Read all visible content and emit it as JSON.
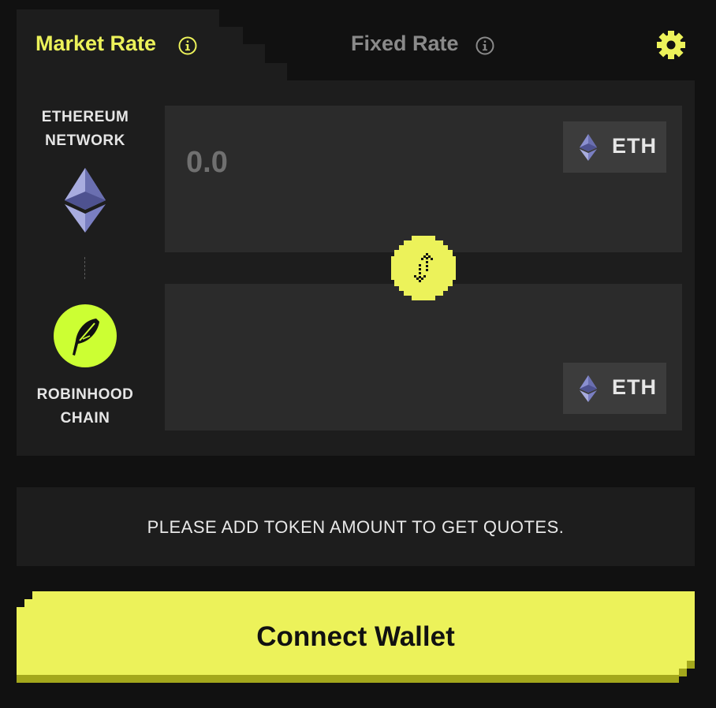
{
  "tabs": {
    "market_rate": "Market Rate",
    "fixed_rate": "Fixed Rate"
  },
  "icons": {
    "info": "info-icon",
    "settings": "gear-icon",
    "eth": "ethereum-icon",
    "robinhood": "feather-icon",
    "swap": "swap-arrows-icon"
  },
  "networks": {
    "source": {
      "line1": "ETHEREUM",
      "line2": "NETWORK"
    },
    "destination": {
      "line1": "ROBINHOOD",
      "line2": "CHAIN"
    }
  },
  "from": {
    "amount_value": "",
    "amount_placeholder": "0.0",
    "token": "ETH"
  },
  "to": {
    "amount_value": "",
    "token": "ETH"
  },
  "quote_message": "PLEASE ADD TOKEN AMOUNT TO GET QUOTES.",
  "connect_button": "Connect Wallet",
  "colors": {
    "accent": "#ecf25a",
    "robinhood_green": "#ccff33",
    "panel": "#1d1d1d",
    "background": "#111111"
  }
}
